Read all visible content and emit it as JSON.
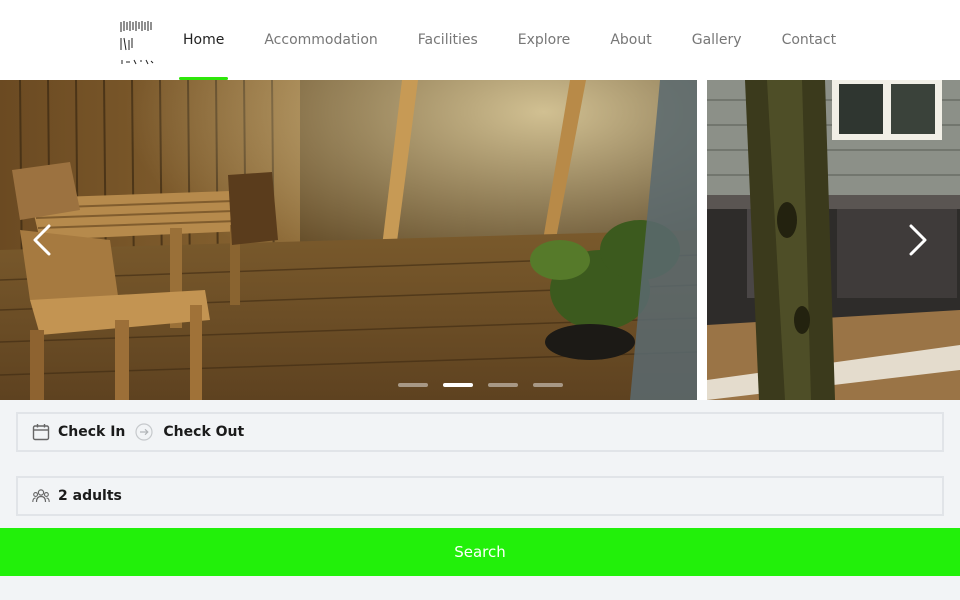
{
  "nav": {
    "items": [
      {
        "label": "Home",
        "active": true
      },
      {
        "label": "Accommodation",
        "active": false
      },
      {
        "label": "Facilities",
        "active": false
      },
      {
        "label": "Explore",
        "active": false
      },
      {
        "label": "About",
        "active": false
      },
      {
        "label": "Gallery",
        "active": false
      },
      {
        "label": "Contact",
        "active": false
      }
    ]
  },
  "carousel": {
    "slide_count": 4,
    "active_slide": 2,
    "prev_icon": "chevron-left-icon",
    "next_icon": "chevron-right-icon"
  },
  "booking": {
    "check_in_label": "Check In",
    "check_out_label": "Check Out",
    "guests_label": "2 adults",
    "search_label": "Search",
    "calendar_icon": "calendar-icon",
    "guests_icon": "users-icon"
  },
  "colors": {
    "accent": "#22f00a",
    "booking_bg": "#f2f4f6",
    "nav_text": "#777777",
    "nav_active": "#222222"
  }
}
